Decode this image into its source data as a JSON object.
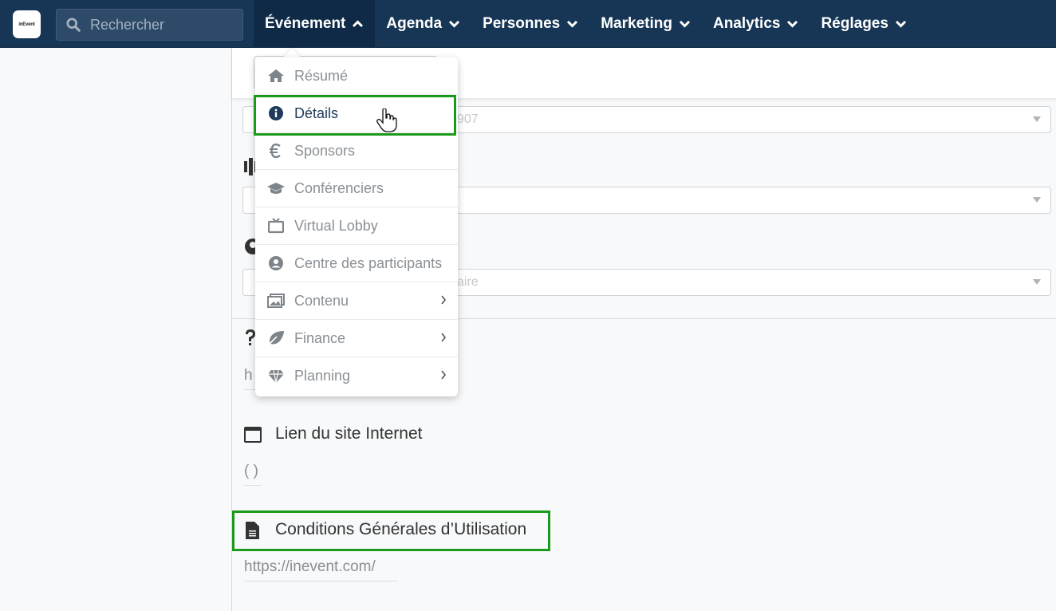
{
  "app": {
    "logo_text": "inEvent"
  },
  "search": {
    "placeholder": "Rechercher"
  },
  "nav": {
    "items": [
      {
        "label": "Événement"
      },
      {
        "label": "Agenda"
      },
      {
        "label": "Personnes"
      },
      {
        "label": "Marketing"
      },
      {
        "label": "Analytics"
      },
      {
        "label": "Réglages"
      }
    ]
  },
  "dropdown": {
    "items": [
      {
        "label": "Résumé",
        "icon": "home-icon"
      },
      {
        "label": "Détails",
        "icon": "info-icon"
      },
      {
        "label": "Sponsors",
        "icon": "euro-icon"
      },
      {
        "label": "Conférenciers",
        "icon": "graduation-cap-icon"
      },
      {
        "label": "Virtual Lobby",
        "icon": "tv-icon"
      },
      {
        "label": "Centre des participants",
        "icon": "user-circle-icon"
      },
      {
        "label": "Contenu",
        "icon": "images-icon"
      },
      {
        "label": "Finance",
        "icon": "leaf-icon"
      },
      {
        "label": "Planning",
        "icon": "diamond-icon"
      }
    ]
  },
  "main": {
    "select1_text": "907",
    "select3_text": "aire",
    "url_partial": "h",
    "website": {
      "title": "Lien du site Internet",
      "value": "( )"
    },
    "terms": {
      "title": "Conditions Générales d’Utilisation",
      "value": "https://inevent.com/"
    }
  },
  "colors": {
    "navbar": "#173656",
    "highlight": "#1a9a1a"
  }
}
